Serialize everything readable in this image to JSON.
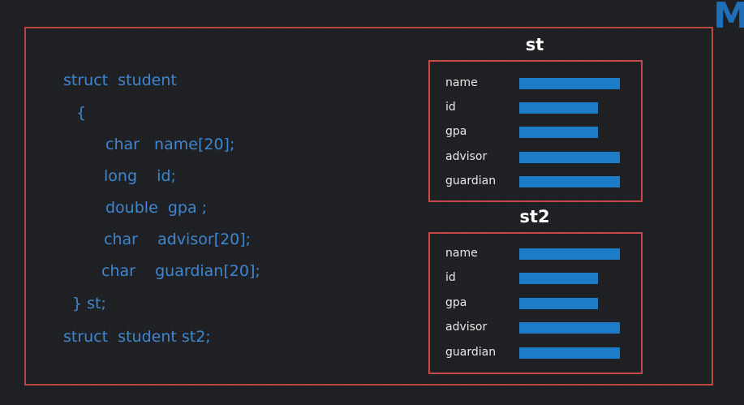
{
  "logo": {
    "text": "M"
  },
  "code": {
    "lines": [
      "struct  student",
      "{",
      "char   name[20];",
      "long    id;",
      "double  gpa ;",
      "char    advisor[20];",
      "char    guardian[20];",
      "} st;",
      "struct  student st2;"
    ]
  },
  "structs": [
    {
      "title": "st",
      "fields": [
        {
          "label": "name",
          "size": 1.0
        },
        {
          "label": "id",
          "size": 0.78
        },
        {
          "label": "gpa",
          "size": 0.78
        },
        {
          "label": "advisor",
          "size": 1.0
        },
        {
          "label": "guardian",
          "size": 1.0
        }
      ]
    },
    {
      "title": "st2",
      "fields": [
        {
          "label": "name",
          "size": 1.0
        },
        {
          "label": "id",
          "size": 0.78
        },
        {
          "label": "gpa",
          "size": 0.78
        },
        {
          "label": "advisor",
          "size": 1.0
        },
        {
          "label": "guardian",
          "size": 1.0
        }
      ]
    }
  ],
  "colors": {
    "code_text": "#3f86cf",
    "frame": "#b8473f",
    "box_border": "#c9494a",
    "bar": "#1c7cc7",
    "logo": "#1f6fb8"
  }
}
